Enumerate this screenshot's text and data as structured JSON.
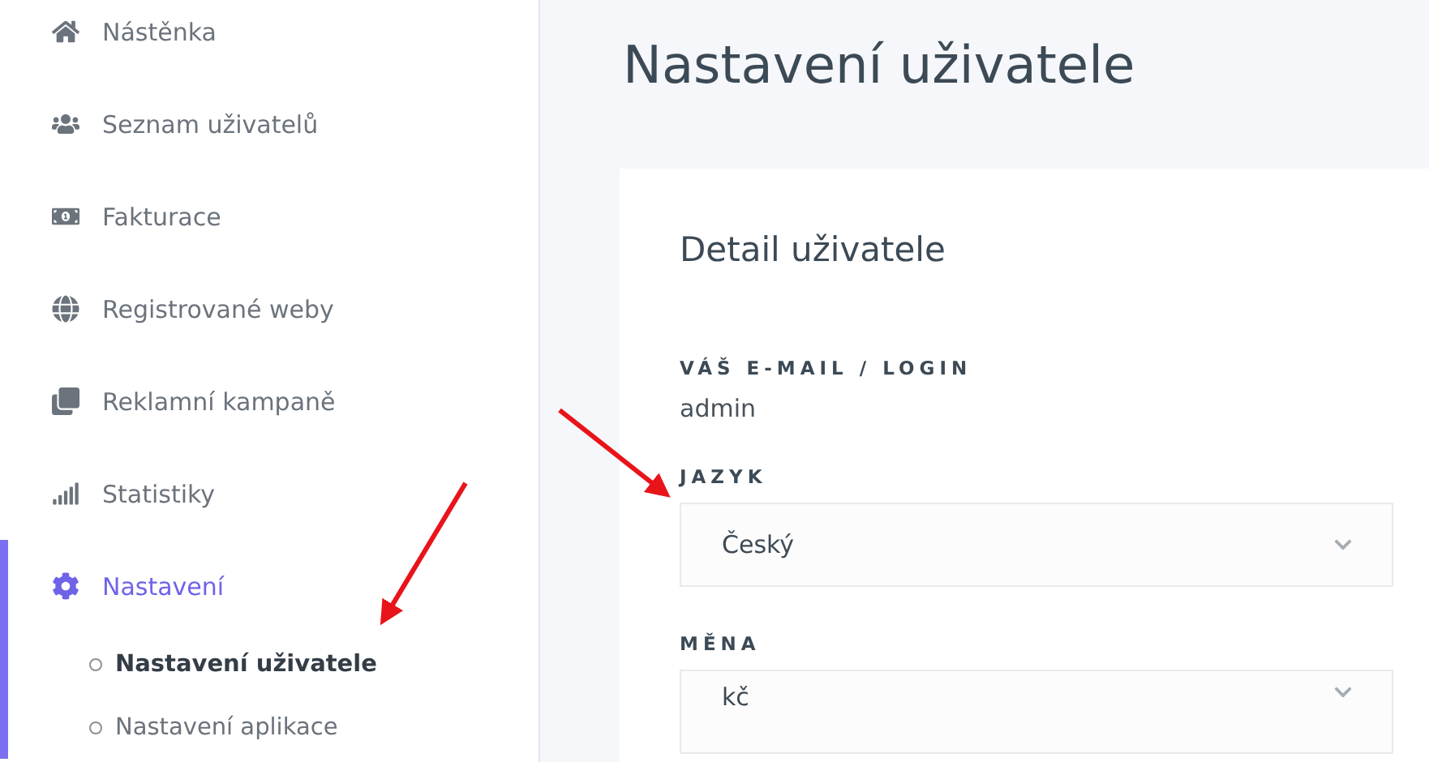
{
  "sidebar": {
    "items": [
      {
        "label": "Nástěnka",
        "selected": false
      },
      {
        "label": "Seznam uživatelů",
        "selected": false
      },
      {
        "label": "Fakturace",
        "selected": false
      },
      {
        "label": "Registrované weby",
        "selected": false
      },
      {
        "label": "Reklamní kampaně",
        "selected": false
      },
      {
        "label": "Statistiky",
        "selected": false
      },
      {
        "label": "Nastavení",
        "selected": true,
        "expanded": true,
        "children": [
          {
            "label": "Nastavení uživatele",
            "selected": true
          },
          {
            "label": "Nastavení aplikace",
            "selected": false
          }
        ]
      }
    ]
  },
  "page": {
    "title": "Nastavení uživatele"
  },
  "card": {
    "title": "Detail uživatele",
    "fields": [
      {
        "kind": "text",
        "label": "VÁŠ E-MAIL / LOGIN",
        "value": "admin"
      },
      {
        "kind": "select",
        "label": "JAZYK",
        "value": "Český"
      },
      {
        "kind": "select",
        "label": "MĚNA",
        "value": "kč"
      }
    ]
  }
}
